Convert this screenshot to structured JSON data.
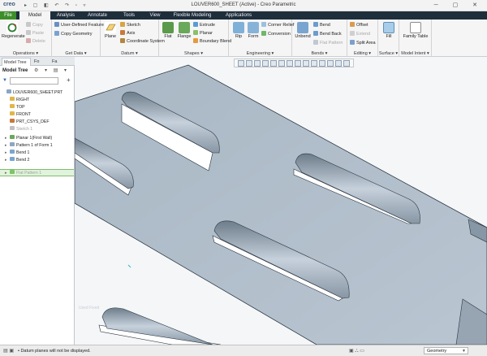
{
  "titlebar": {
    "logo": "creo",
    "quick_access": "▸ ▢ ◧ ↶ ↷ ▫ ▿",
    "window_title": "LOUVER600_SHEET (Active) - Creo Parametric",
    "window_controls": "─ ▢ ✕"
  },
  "menu_tabs": [
    "File",
    "Model",
    "Analysis",
    "Annotate",
    "Tools",
    "View",
    "Flexible Modeling",
    "Applications"
  ],
  "ribbon": {
    "operations": {
      "regenerate": "Regenerate",
      "copy": "Copy",
      "paste": "Paste",
      "delete": "Delete",
      "group": "Operations ▾"
    },
    "get_data": {
      "udf": "User-Defined Feature",
      "copy_geometry": "Copy Geometry",
      "group": "Get Data ▾"
    },
    "datum": {
      "plane": "Plane",
      "sketch": "Sketch",
      "axis": "Axis",
      "csys": "Coordinate System",
      "group": "Datum ▾"
    },
    "shapes": {
      "flat": "Flat",
      "flange": "Flange",
      "extrude": "Extrude",
      "planar": "Planar",
      "boundary_blend": "Boundary Blend",
      "group": "Shapes ▾"
    },
    "engineering": {
      "rip": "Rip",
      "form": "Form",
      "corner_relief": "Corner Relief",
      "conversion": "Conversion",
      "group": "Engineering ▾"
    },
    "bends": {
      "unbend": "Unbend",
      "bend": "Bend",
      "bend_back": "Bend Back",
      "flat_pattern": "Flat Pattern",
      "group": "Bends ▾"
    },
    "editing": {
      "offset": "Offset",
      "extend": "Extend",
      "split_area": "Split Area",
      "group": "Editing ▾"
    },
    "surface": {
      "fill": "Fill",
      "group": "Surface ▾"
    },
    "model_intent": {
      "family_table": "Family Table",
      "group": "Model Intent ▾"
    }
  },
  "sidebar": {
    "tabs": [
      "Model Tree",
      "Fo",
      "Fa"
    ],
    "header": "Model Tree",
    "tree_tools": "⚙ ▾ ▤ ▾",
    "items": [
      {
        "label": "LOUVER600_SHEET.PRT",
        "icon": "part-icon",
        "greyed": false,
        "expander": ""
      },
      {
        "label": "RIGHT",
        "icon": "datum-plane-icon",
        "greyed": false,
        "expander": ""
      },
      {
        "label": "TOP",
        "icon": "datum-plane-icon",
        "greyed": false,
        "expander": ""
      },
      {
        "label": "FRONT",
        "icon": "datum-plane-icon",
        "greyed": false,
        "expander": ""
      },
      {
        "label": "PRT_CSYS_DEF",
        "icon": "csys-icon",
        "greyed": false,
        "expander": ""
      },
      {
        "label": "Sketch 1",
        "icon": "sketch-icon",
        "greyed": true,
        "expander": ""
      },
      {
        "label": "Planar 1(First Wall)",
        "icon": "wall-icon",
        "greyed": false,
        "expander": "▸"
      },
      {
        "label": "Pattern 1 of Form 1",
        "icon": "pattern-icon",
        "greyed": false,
        "expander": "▸"
      },
      {
        "label": "Bend 1",
        "icon": "bend-icon",
        "greyed": false,
        "expander": "▸"
      },
      {
        "label": "Bend 2",
        "icon": "bend-icon",
        "greyed": false,
        "expander": "▸"
      },
      {
        "label": "Flat Pattern 1",
        "icon": "flat-pattern-icon",
        "greyed": true,
        "expander": "▸"
      }
    ]
  },
  "viewport": {
    "watermark": "Used Fixed"
  },
  "status": {
    "icons": "▤ ▣",
    "message": "• Datum planes will not be displayed.",
    "right_icons": "▣   ⛬ ▭",
    "filter_value": "Geometry"
  }
}
